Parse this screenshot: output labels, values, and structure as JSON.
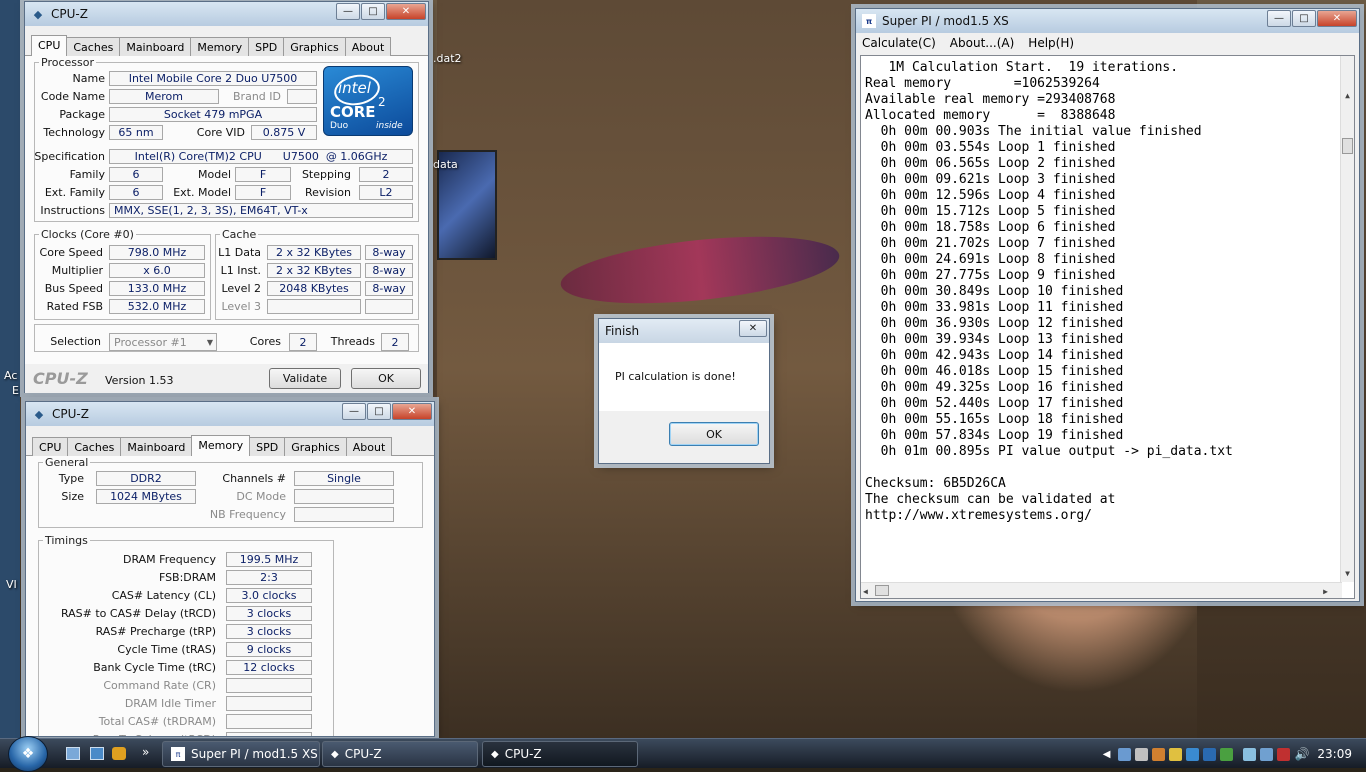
{
  "desktop": {
    "icons": [
      {
        "label": ".dat2"
      },
      {
        "label": "data"
      },
      {
        "label": "Ac"
      },
      {
        "label": "E"
      },
      {
        "label": "VI"
      }
    ]
  },
  "cpuz_cpu": {
    "title": "CPU-Z",
    "tabs": [
      "CPU",
      "Caches",
      "Mainboard",
      "Memory",
      "SPD",
      "Graphics",
      "About"
    ],
    "processor": {
      "legend": "Processor",
      "name_label": "Name",
      "name": "Intel Mobile Core 2 Duo U7500",
      "codename_label": "Code Name",
      "codename": "Merom",
      "brandid_label": "Brand ID",
      "brandid": "",
      "package_label": "Package",
      "package": "Socket 479 mPGA",
      "technology_label": "Technology",
      "technology": "65 nm",
      "corevid_label": "Core VID",
      "corevid": "0.875 V",
      "spec_label": "Specification",
      "spec": "Intel(R) Core(TM)2 CPU      U7500  @ 1.06GHz",
      "family_label": "Family",
      "family": "6",
      "model_label": "Model",
      "model": "F",
      "stepping_label": "Stepping",
      "stepping": "2",
      "extfamily_label": "Ext. Family",
      "extfamily": "6",
      "extmodel_label": "Ext. Model",
      "extmodel": "F",
      "revision_label": "Revision",
      "revision": "L2",
      "instructions_label": "Instructions",
      "instructions": "MMX, SSE(1, 2, 3, 3S), EM64T, VT-x"
    },
    "logo": {
      "brand": "intel",
      "core": "CORE",
      "sup": "2",
      "duo": "Duo",
      "inside": "inside"
    },
    "clocks": {
      "legend": "Clocks (Core #0)",
      "corespeed_label": "Core Speed",
      "corespeed": "798.0 MHz",
      "multiplier_label": "Multiplier",
      "multiplier": "x 6.0",
      "busspeed_label": "Bus Speed",
      "busspeed": "133.0 MHz",
      "ratedfsb_label": "Rated FSB",
      "ratedfsb": "532.0 MHz"
    },
    "cache": {
      "legend": "Cache",
      "l1data_label": "L1 Data",
      "l1data": "2 x 32 KBytes",
      "l1data_way": "8-way",
      "l1inst_label": "L1 Inst.",
      "l1inst": "2 x 32 KBytes",
      "l1inst_way": "8-way",
      "level2_label": "Level 2",
      "level2": "2048 KBytes",
      "level2_way": "8-way",
      "level3_label": "Level 3",
      "level3": "",
      "level3_way": ""
    },
    "selection_label": "Selection",
    "selection": "Processor #1",
    "cores_label": "Cores",
    "cores": "2",
    "threads_label": "Threads",
    "threads": "2",
    "brand_text": "CPU-Z",
    "version": "Version 1.53",
    "validate_label": "Validate",
    "ok_label": "OK"
  },
  "cpuz_mem": {
    "title": "CPU-Z",
    "tabs": [
      "CPU",
      "Caches",
      "Mainboard",
      "Memory",
      "SPD",
      "Graphics",
      "About"
    ],
    "general": {
      "legend": "General",
      "type_label": "Type",
      "type": "DDR2",
      "channels_label": "Channels #",
      "channels": "Single",
      "size_label": "Size",
      "size": "1024 MBytes",
      "dcmode_label": "DC Mode",
      "dcmode": "",
      "nbfreq_label": "NB Frequency",
      "nbfreq": ""
    },
    "timings": {
      "legend": "Timings",
      "rows": [
        {
          "label": "DRAM Frequency",
          "value": "199.5 MHz",
          "dim": false
        },
        {
          "label": "FSB:DRAM",
          "value": "2:3",
          "dim": false
        },
        {
          "label": "CAS# Latency (CL)",
          "value": "3.0 clocks",
          "dim": false
        },
        {
          "label": "RAS# to CAS# Delay (tRCD)",
          "value": "3 clocks",
          "dim": false
        },
        {
          "label": "RAS# Precharge (tRP)",
          "value": "3 clocks",
          "dim": false
        },
        {
          "label": "Cycle Time (tRAS)",
          "value": "9 clocks",
          "dim": false
        },
        {
          "label": "Bank Cycle Time (tRC)",
          "value": "12 clocks",
          "dim": false
        },
        {
          "label": "Command Rate (CR)",
          "value": "",
          "dim": true
        },
        {
          "label": "DRAM Idle Timer",
          "value": "",
          "dim": true
        },
        {
          "label": "Total CAS# (tRDRAM)",
          "value": "",
          "dim": true
        },
        {
          "label": "Row To Column (tRCD)",
          "value": "",
          "dim": true
        }
      ]
    }
  },
  "finish_dialog": {
    "title": "Finish",
    "message": "PI calculation is done!",
    "ok_label": "OK"
  },
  "superpi": {
    "title": "Super PI / mod1.5 XS",
    "menu": [
      "Calculate(C)",
      "About...(A)",
      "Help(H)"
    ],
    "lines": [
      "   1M Calculation Start.  19 iterations.",
      "Real memory        =1062539264",
      "Available real memory =293408768",
      "Allocated memory      =  8388648",
      "  0h 00m 00.903s The initial value finished",
      "  0h 00m 03.554s Loop 1 finished",
      "  0h 00m 06.565s Loop 2 finished",
      "  0h 00m 09.621s Loop 3 finished",
      "  0h 00m 12.596s Loop 4 finished",
      "  0h 00m 15.712s Loop 5 finished",
      "  0h 00m 18.758s Loop 6 finished",
      "  0h 00m 21.702s Loop 7 finished",
      "  0h 00m 24.691s Loop 8 finished",
      "  0h 00m 27.775s Loop 9 finished",
      "  0h 00m 30.849s Loop 10 finished",
      "  0h 00m 33.981s Loop 11 finished",
      "  0h 00m 36.930s Loop 12 finished",
      "  0h 00m 39.934s Loop 13 finished",
      "  0h 00m 42.943s Loop 14 finished",
      "  0h 00m 46.018s Loop 15 finished",
      "  0h 00m 49.325s Loop 16 finished",
      "  0h 00m 52.440s Loop 17 finished",
      "  0h 00m 55.165s Loop 18 finished",
      "  0h 00m 57.834s Loop 19 finished",
      "  0h 01m 00.895s PI value output -> pi_data.txt",
      "",
      "Checksum: 6B5D26CA",
      "The checksum can be validated at",
      "http://www.xtremesystems.org/"
    ]
  },
  "taskbar": {
    "items": [
      "Super PI / mod1.5 XS",
      "CPU-Z",
      "CPU-Z"
    ],
    "clock": "23:09"
  }
}
